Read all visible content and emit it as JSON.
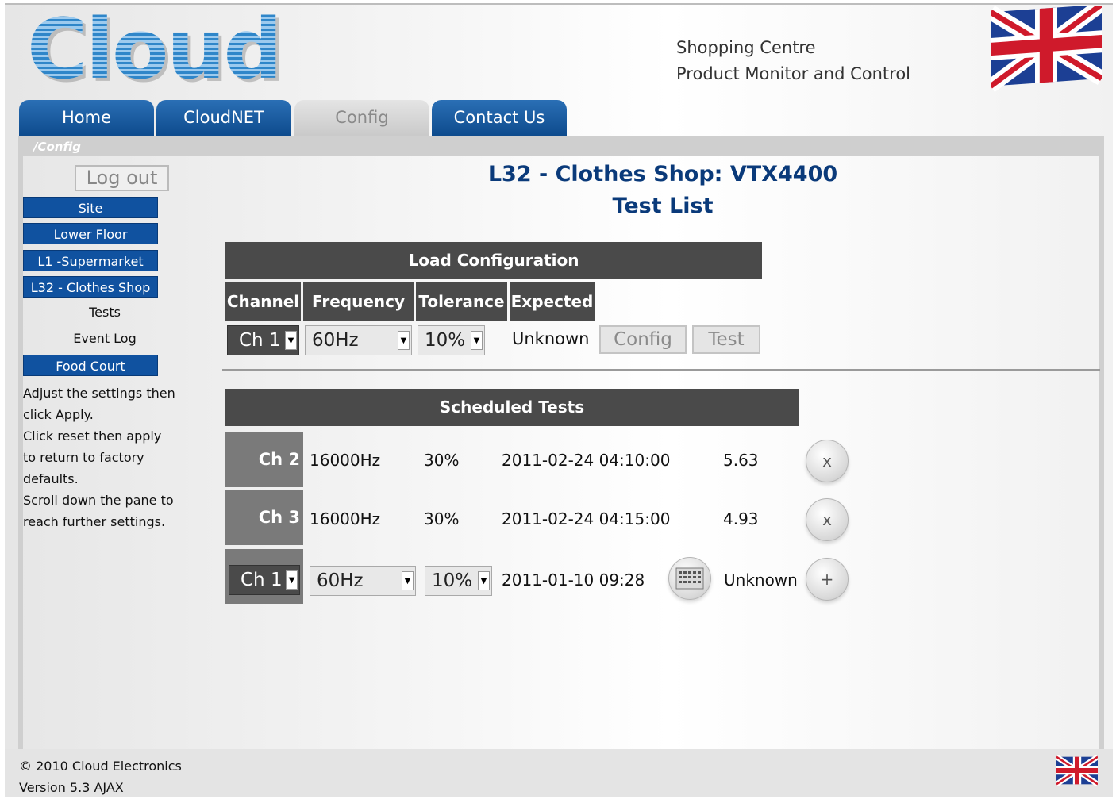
{
  "brand": {
    "logo_text": "Cloud"
  },
  "header": {
    "line1": "Shopping Centre",
    "line2": "Product Monitor and Control"
  },
  "tabs": [
    {
      "label": "Home"
    },
    {
      "label": "CloudNET"
    },
    {
      "label": "Config"
    },
    {
      "label": "Contact Us"
    }
  ],
  "breadcrumb": "/Config",
  "sidebar": {
    "logout": "Log out",
    "items": [
      {
        "label": "Site"
      },
      {
        "label": "Lower Floor"
      },
      {
        "label": "L1 -Supermarket"
      },
      {
        "label": "L32 - Clothes Shop"
      },
      {
        "label": "Tests"
      },
      {
        "label": "Event Log"
      },
      {
        "label": "Food Court"
      }
    ],
    "help": [
      "Adjust the settings then",
      "click Apply.",
      "Click reset then apply",
      "to return to factory",
      "defaults.",
      "Scroll down the pane to",
      "reach further settings."
    ]
  },
  "page": {
    "title": "L32 - Clothes Shop: VTX4400",
    "subtitle": "Test List"
  },
  "load_config": {
    "heading": "Load Configuration",
    "columns": [
      "Channel",
      "Frequency",
      "Tolerance",
      "Expected"
    ],
    "channel": "Ch 1",
    "frequency": "60Hz",
    "tolerance": "10%",
    "expected": "Unknown",
    "config_btn": "Config",
    "test_btn": "Test"
  },
  "scheduled": {
    "heading": "Scheduled Tests",
    "rows": [
      {
        "channel": "Ch 2",
        "frequency": "16000Hz",
        "tolerance": "30%",
        "datetime": "2011-02-24 04:10:00",
        "value": "5.63",
        "action": "x"
      },
      {
        "channel": "Ch 3",
        "frequency": "16000Hz",
        "tolerance": "30%",
        "datetime": "2011-02-24 04:15:00",
        "value": "4.93",
        "action": "x"
      }
    ],
    "new_row": {
      "channel": "Ch 1",
      "frequency": "60Hz",
      "tolerance": "10%",
      "datetime": "2011-01-10 09:28",
      "value": "Unknown",
      "action": "+"
    }
  },
  "footer": {
    "copyright": "© 2010 Cloud Electronics",
    "version": "Version 5.3 AJAX"
  },
  "icons": {
    "flag": "union-jack-flag-icon",
    "calendar": "calendar-icon",
    "arrow": "chevron-down-icon"
  },
  "colors": {
    "nav_blue": "#0d4a8c",
    "title_blue": "#0a3a7a",
    "dark_gray": "#4a4a4a"
  }
}
